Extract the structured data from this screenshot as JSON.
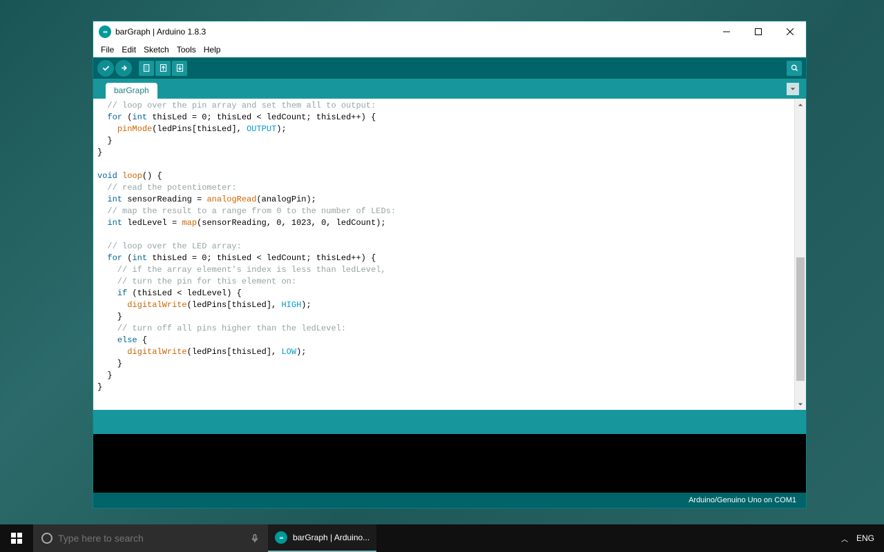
{
  "window": {
    "title": "barGraph | Arduino 1.8.3",
    "app_icon_text": "∞"
  },
  "menu": {
    "file": "File",
    "edit": "Edit",
    "sketch": "Sketch",
    "tools": "Tools",
    "help": "Help"
  },
  "tab": {
    "name": "barGraph"
  },
  "code": {
    "l0": "  // loop over the pin array and set them all to output:",
    "l1a": "  ",
    "l1b": "for",
    "l1c": " (",
    "l1d": "int",
    "l1e": " thisLed = 0; thisLed < ledCount; thisLed++) {",
    "l2a": "    ",
    "l2b": "pinMode",
    "l2c": "(ledPins[thisLed], ",
    "l2d": "OUTPUT",
    "l2e": ");",
    "l3": "  }",
    "l4": "}",
    "l5": "",
    "l6a": "",
    "l6b": "void",
    "l6c": " ",
    "l6d": "loop",
    "l6e": "() {",
    "l7": "  // read the potentiometer:",
    "l8a": "  ",
    "l8b": "int",
    "l8c": " sensorReading = ",
    "l8d": "analogRead",
    "l8e": "(analogPin);",
    "l9": "  // map the result to a range from 0 to the number of LEDs:",
    "l10a": "  ",
    "l10b": "int",
    "l10c": " ledLevel = ",
    "l10d": "map",
    "l10e": "(sensorReading, 0, 1023, 0, ledCount);",
    "l11": "",
    "l12": "  // loop over the LED array:",
    "l13a": "  ",
    "l13b": "for",
    "l13c": " (",
    "l13d": "int",
    "l13e": " thisLed = 0; thisLed < ledCount; thisLed++) {",
    "l14": "    // if the array element's index is less than ledLevel,",
    "l15": "    // turn the pin for this element on:",
    "l16a": "    ",
    "l16b": "if",
    "l16c": " (thisLed < ledLevel) {",
    "l17a": "      ",
    "l17b": "digitalWrite",
    "l17c": "(ledPins[thisLed], ",
    "l17d": "HIGH",
    "l17e": ");",
    "l18": "    }",
    "l19": "    // turn off all pins higher than the ledLevel:",
    "l20a": "    ",
    "l20b": "else",
    "l20c": " {",
    "l21a": "      ",
    "l21b": "digitalWrite",
    "l21c": "(ledPins[thisLed], ",
    "l21d": "LOW",
    "l21e": ");",
    "l22": "    }",
    "l23": "  }",
    "l24": "}"
  },
  "footer": {
    "board": "Arduino/Genuino Uno on COM1"
  },
  "taskbar": {
    "search_placeholder": "Type here to search",
    "app_label": "barGraph | Arduino...",
    "lang": "ENG"
  }
}
